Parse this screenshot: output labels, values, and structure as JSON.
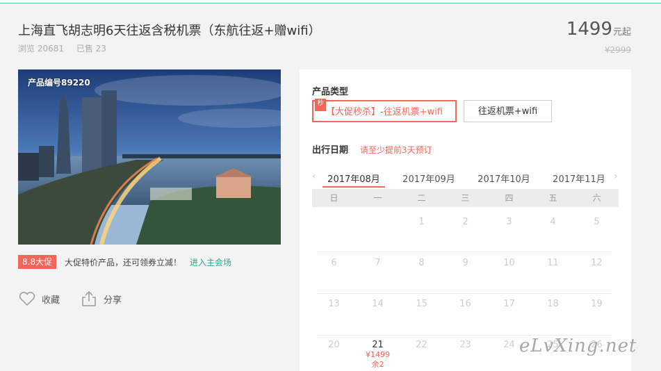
{
  "product": {
    "title": "上海直飞胡志明6天往返含税机票（东航往返+赠wifi）",
    "views": "浏览 20681",
    "sold": "已售 23",
    "price": "1499",
    "price_unit": "元起",
    "original_price": "¥2999",
    "code": "产品编号89220"
  },
  "promo": {
    "badge": "8.8大促",
    "text": "大促特价产品，还可领券立减！",
    "link": "进入主会场"
  },
  "actions": {
    "favorite": "收藏",
    "share": "分享"
  },
  "booking": {
    "type_label": "产品类型",
    "options": [
      {
        "label": "【大促秒杀】-往返机票+wifi",
        "tag": "秒",
        "selected": true
      },
      {
        "label": "往返机票+wifi",
        "selected": false
      }
    ],
    "date_label": "出行日期",
    "date_hint": "请至少提前3天预订",
    "months": [
      "2017年08月",
      "2017年09月",
      "2017年10月",
      "2017年11月"
    ],
    "active_month": "2017年08月",
    "weekdays": [
      "日",
      "一",
      "二",
      "三",
      "四",
      "五",
      "六"
    ],
    "weeks": [
      [
        "",
        "",
        "1",
        "2",
        "3",
        "4",
        "5"
      ],
      [
        "6",
        "7",
        "8",
        "9",
        "10",
        "11",
        "12"
      ],
      [
        "13",
        "14",
        "15",
        "16",
        "17",
        "18",
        "19"
      ],
      [
        "20",
        "21",
        "22",
        "23",
        "24",
        "25",
        "26"
      ]
    ],
    "available_day": {
      "day": "21",
      "price": "¥1499",
      "stock": "余2"
    }
  },
  "watermark": "eLvXing.net",
  "colors": {
    "accent": "#f2665a",
    "link": "#2aa98a",
    "top_border": "#5fc0b0"
  },
  "icons": {
    "favorite": "heart-outline-icon",
    "share": "share-upload-icon",
    "prev": "chevron-left-icon",
    "next": "chevron-right-icon"
  }
}
